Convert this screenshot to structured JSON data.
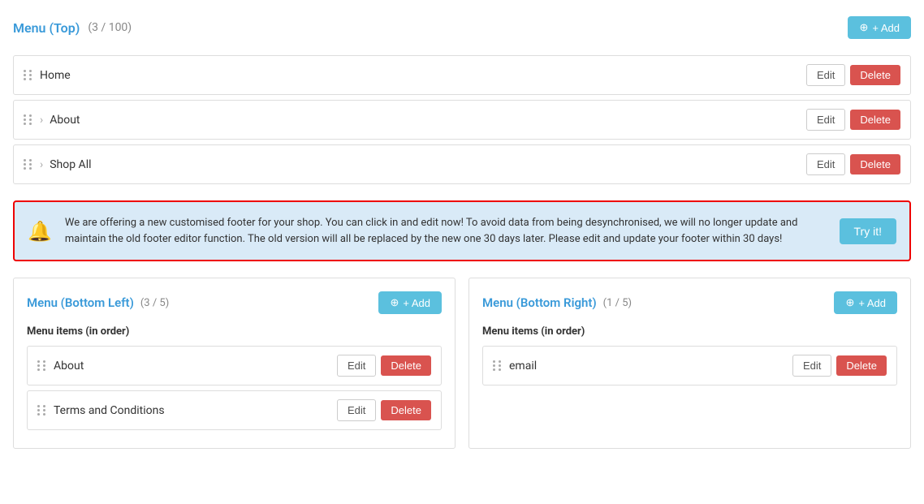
{
  "topMenu": {
    "title": "Menu (Top)",
    "count": "(3 / 100)",
    "addLabel": "+ Add",
    "items": [
      {
        "label": "Home",
        "hasArrow": false
      },
      {
        "label": "About",
        "hasArrow": true
      },
      {
        "label": "Shop All",
        "hasArrow": true
      }
    ],
    "editLabel": "Edit",
    "deleteLabel": "Delete"
  },
  "alert": {
    "text": "We are offering a new customised footer for your shop. You can click in and edit now! To avoid data from being desynchronised, we will no longer update and maintain the old footer editor function. The old version will all be replaced by the new one 30 days later. Please edit and update your footer within 30 days!",
    "buttonLabel": "Try it!"
  },
  "bottomLeft": {
    "title": "Menu (Bottom Left)",
    "count": "(3 / 5)",
    "addLabel": "+ Add",
    "menuItemsLabel": "Menu items (in order)",
    "items": [
      {
        "label": "About"
      },
      {
        "label": "Terms and Conditions"
      }
    ],
    "editLabel": "Edit",
    "deleteLabel": "Delete"
  },
  "bottomRight": {
    "title": "Menu (Bottom Right)",
    "count": "(1 / 5)",
    "addLabel": "+ Add",
    "menuItemsLabel": "Menu items (in order)",
    "items": [
      {
        "label": "email"
      }
    ],
    "editLabel": "Edit",
    "deleteLabel": "Delete"
  }
}
